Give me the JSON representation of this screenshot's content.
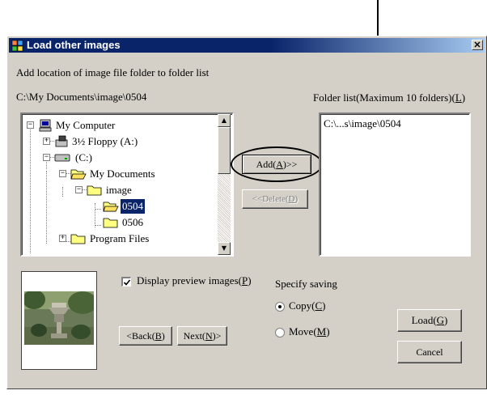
{
  "window": {
    "title": "Load other images",
    "close": "✕"
  },
  "instruction": "Add location of image file folder to folder list",
  "current_path": "C:\\My Documents\\image\\0504",
  "folder_list": {
    "label_prefix": "Folder list(Maximum 10 folders)(",
    "label_key": "L",
    "label_suffix": ")",
    "items": [
      "C:\\...s\\image\\0504"
    ]
  },
  "tree": {
    "items": [
      {
        "label": "My Computer",
        "icon": "computer-icon"
      },
      {
        "label": "3½ Floppy (A:)",
        "icon": "floppy-icon"
      },
      {
        "label": "(C:)",
        "icon": "drive-icon"
      },
      {
        "label": "My Documents",
        "icon": "open-folder-icon"
      },
      {
        "label": "image",
        "icon": "folder-icon"
      },
      {
        "label": "0504",
        "icon": "open-folder-icon",
        "selected": true
      },
      {
        "label": "0506",
        "icon": "folder-icon"
      },
      {
        "label": "Program Files",
        "icon": "folder-icon"
      }
    ]
  },
  "buttons": {
    "add": {
      "pre": "Add(",
      "key": "A",
      "post": ")>>"
    },
    "delete": {
      "pre": "<<Delete(",
      "key": "D",
      "post": ")"
    },
    "back": {
      "pre": "<Back(",
      "key": "B",
      "post": ")"
    },
    "next": {
      "pre": "Next(",
      "key": "N",
      "post": ")>"
    },
    "load": {
      "pre": "Load(",
      "key": "G",
      "post": ")"
    },
    "cancel": "Cancel"
  },
  "preview_checkbox": {
    "pre": "Display preview images(",
    "key": "P",
    "post": ")",
    "checked": true
  },
  "saving": {
    "label": "Specify saving",
    "copy": {
      "pre": "Copy(",
      "key": "C",
      "post": ")",
      "selected": true
    },
    "move": {
      "pre": "Move(",
      "key": "M",
      "post": ")",
      "selected": false
    }
  },
  "colors": {
    "title_bar": "#0a246a",
    "selection": "#0a246a",
    "face": "#d4d0c8"
  }
}
